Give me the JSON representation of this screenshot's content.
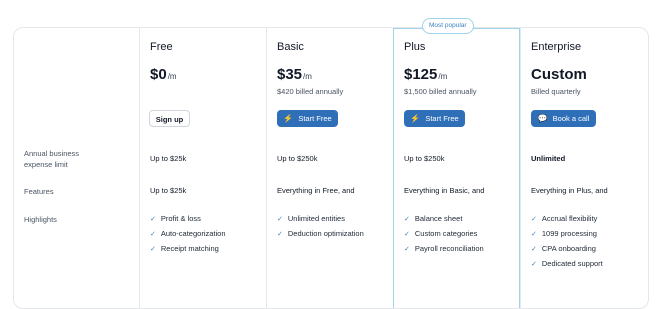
{
  "most_popular": "Most popular",
  "row_labels": {
    "expense_limit": "Annual business expense limit",
    "features": "Features",
    "highlights": "Highlights"
  },
  "plans": [
    {
      "name": "Free",
      "price": "$0",
      "unit": "/m",
      "note": "",
      "cta": "Sign up",
      "cta_style": "outline",
      "expense_limit": "Up to $25k",
      "features": "Up to $25k",
      "highlights": [
        "Profit & loss",
        "Auto-categorization",
        "Receipt matching"
      ]
    },
    {
      "name": "Basic",
      "price": "$35",
      "unit": "/m",
      "note": "$420 billed annually",
      "cta": "Start Free",
      "cta_style": "primary",
      "expense_limit": "Up to $250k",
      "features": "Everything in Free, and",
      "highlights": [
        "Unlimited entities",
        "Deduction optimization"
      ]
    },
    {
      "name": "Plus",
      "price": "$125",
      "unit": "/m",
      "note": "$1,500 billed annually",
      "cta": "Start Free",
      "cta_style": "primary",
      "expense_limit": "Up to $250k",
      "features": "Everything in Basic, and",
      "highlights": [
        "Balance sheet",
        "Custom categories",
        "Payroll reconciliation"
      ]
    },
    {
      "name": "Enterprise",
      "price": "Custom",
      "unit": "",
      "note": "Billed quarterly",
      "cta": "Book a call",
      "cta_style": "primary",
      "expense_limit": "Unlimited",
      "features": "Everything in Plus, and",
      "highlights": [
        "Accrual flexibility",
        "1099 processing",
        "CPA onboarding",
        "Dedicated support"
      ]
    }
  ],
  "icons": {
    "start": "lightning-icon",
    "call": "chat-bubble-icon",
    "check": "check-icon"
  },
  "colors": {
    "primary": "#2f6fb8",
    "highlight_border": "#9fd3ea",
    "check": "#3b82c4"
  }
}
